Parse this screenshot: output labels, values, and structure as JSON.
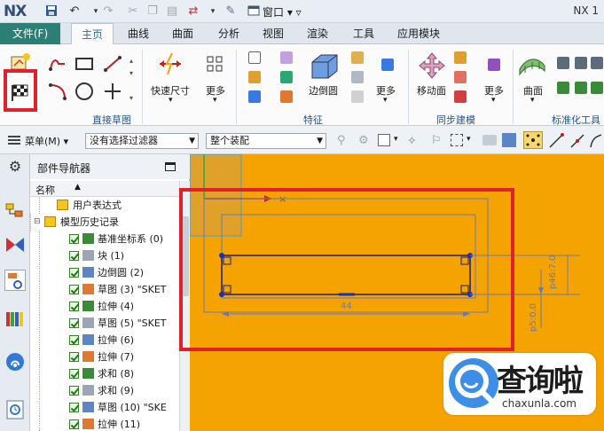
{
  "app": {
    "logo": "NX",
    "title": "NX 1",
    "window_menu": "窗口"
  },
  "tabs": [
    {
      "label": "文件(F)"
    },
    {
      "label": "主页"
    },
    {
      "label": "曲线"
    },
    {
      "label": "曲面"
    },
    {
      "label": "分析"
    },
    {
      "label": "视图"
    },
    {
      "label": "渲染"
    },
    {
      "label": "工具"
    },
    {
      "label": "应用模块"
    }
  ],
  "ribbon": {
    "groups": {
      "direct_sketch": "直接草图",
      "feature": "特征",
      "sync_modeling": "同步建模",
      "std_tools": "标准化工具"
    },
    "buttons": {
      "quick_dim": "快速尺寸",
      "more1": "更多",
      "edge_blend": "边倒圆",
      "more2": "更多",
      "move_face": "移动面",
      "more3": "更多",
      "surface": "曲面"
    }
  },
  "toolbar": {
    "menu": "菜单(M)",
    "filter": "没有选择过滤器",
    "assembly": "整个装配"
  },
  "navigator": {
    "title": "部件导航器",
    "column_name": "名称",
    "items": [
      {
        "label": "用户表达式",
        "level": 1,
        "checked": false
      },
      {
        "label": "模型历史记录",
        "level": 0,
        "checked": false
      },
      {
        "label": "基准坐标系 (0)",
        "level": 2,
        "checked": true
      },
      {
        "label": "块 (1)",
        "level": 2,
        "checked": true
      },
      {
        "label": "边倒圆 (2)",
        "level": 2,
        "checked": true
      },
      {
        "label": "草图 (3) \"SKET",
        "level": 2,
        "checked": true
      },
      {
        "label": "拉伸 (4)",
        "level": 2,
        "checked": true
      },
      {
        "label": "草图 (5) \"SKET",
        "level": 2,
        "checked": true
      },
      {
        "label": "拉伸 (6)",
        "level": 2,
        "checked": true
      },
      {
        "label": "拉伸 (7)",
        "level": 2,
        "checked": true
      },
      {
        "label": "求和 (8)",
        "level": 2,
        "checked": true
      },
      {
        "label": "求和 (9)",
        "level": 2,
        "checked": true
      },
      {
        "label": "草图 (10) \"SKE",
        "level": 2,
        "checked": true
      },
      {
        "label": "拉伸 (11)",
        "level": 2,
        "checked": true
      }
    ]
  },
  "graphics": {
    "dimension_bottom": "44",
    "dimension_right_1": "p46:7.0",
    "dimension_right_2": "p5:0.0"
  },
  "watermark": {
    "title": "查询啦",
    "subtitle": "chaxunla.com"
  },
  "colors": {
    "file_tab": "#2b7f74",
    "graphics_bg": "#f5a300",
    "highlight": "#e0202a"
  }
}
